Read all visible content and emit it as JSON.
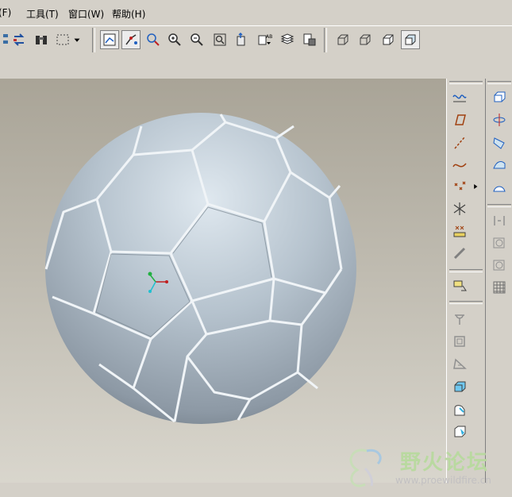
{
  "menubar": {
    "items": [
      {
        "label": "(F)"
      },
      {
        "label": "工具(T)"
      },
      {
        "label": "窗口(W)"
      },
      {
        "label": "帮助(H)"
      }
    ]
  },
  "toolbar": {
    "buttons": [
      "tree-icon",
      "regenerate-icon",
      "binoculars-icon",
      "select-box-icon",
      "dropdown-arrow-icon",
      "repaint-icon",
      "spin-center-icon",
      "orient-mode-icon",
      "zoom-in-icon",
      "zoom-out-icon",
      "refit-icon",
      "reorient-icon",
      "saved-views-icon",
      "layers-icon",
      "view-manager-icon",
      "wireframe-icon",
      "hidden-line-icon",
      "no-hidden-icon",
      "shading-icon"
    ]
  },
  "right_toolbar": {
    "datum_tools": [
      "datum-plane-icon",
      "datum-axis-icon",
      "datum-curve-icon",
      "datum-point-icon",
      "datum-csys-icon",
      "analysis-icon",
      "round-chain-icon",
      "annotation-icon"
    ],
    "edit_tools": [
      "sketch-icon",
      "mirror-icon",
      "round-icon",
      "draft-icon",
      "shell-icon",
      "rib-icon"
    ],
    "feature_tools": [
      "extrude-icon",
      "revolve-icon",
      "sweep-icon",
      "blend-icon",
      "boundary-icon",
      "hole-icon",
      "shell-feature-icon",
      "pattern-icon"
    ]
  },
  "watermark": {
    "title": "野火论坛",
    "url": "www.proewildfire.cn"
  },
  "colors": {
    "background_top": "#a9a497",
    "background_bottom": "#d9d6cd",
    "ball_main": "#aebac6",
    "ball_seam": "#f2f5f7"
  }
}
